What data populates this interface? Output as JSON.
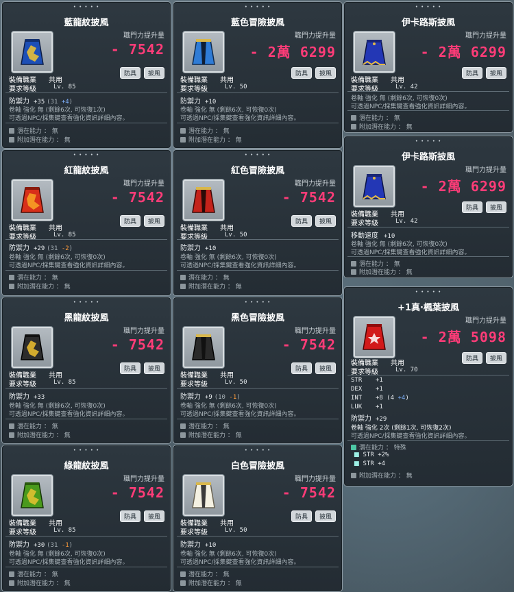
{
  "labels": {
    "atk_label": "職門力提升量",
    "badge_armor": "防具",
    "badge_cape": "披風",
    "job_label": "裝備職業",
    "job_value": "共用",
    "req_label": "要求等級",
    "stars": "• • • • •",
    "potential": "潛在能力 ： 無",
    "add_potential": "附加潛在能力 ： 無",
    "upgrade_text": "可透過NPC/採集鍵查看強化資訊詳細內容。"
  },
  "cards": {
    "c1": {
      "name": "藍龍紋披風",
      "atk": "- 7542",
      "lvl": "Lv. 85",
      "def_label": "防禦力",
      "def": "+35",
      "def_extra_a": "(31 ",
      "def_extra_b": "+4",
      "def_extra_c": ")",
      "scroll": "卷軸 強化 無 (剩餘6次, 可恢復1次)"
    },
    "c2": {
      "name": "藍色冒險披風",
      "atk": "- 2萬 6299",
      "lvl": "Lv. 50",
      "def_label": "防禦力",
      "def": "+10",
      "scroll": "卷軸 強化 無 (剩餘6次, 可恢復0次)"
    },
    "c3": {
      "name": "伊卡路斯披風",
      "atk": "- 2萬 6299",
      "lvl": "Lv. 42",
      "scroll": "卷軸 強化 無 (剩餘6次, 可恢復0次)"
    },
    "c4": {
      "name": "紅龍紋披風",
      "atk": "- 7542",
      "lvl": "Lv. 85",
      "def_label": "防禦力",
      "def": "+29",
      "def_extra_a": "(31 ",
      "def_extra_b": "-2",
      "def_extra_c": ")",
      "scroll": "卷軸 強化 無 (剩餘6次, 可恢復0次)"
    },
    "c5": {
      "name": "紅色冒險披風",
      "atk": "- 7542",
      "lvl": "Lv. 50",
      "def_label": "防禦力",
      "def": "+10",
      "scroll": "卷軸 強化 無 (剩餘6次, 可恢復0次)"
    },
    "c6": {
      "name": "伊卡路斯披風",
      "atk": "- 2萬 6299",
      "lvl": "Lv. 42",
      "stat_label": "移動速度",
      "stat": "+10",
      "scroll": "卷軸 強化 無 (剩餘6次, 可恢復0次)"
    },
    "c7": {
      "name": "黑龍紋披風",
      "atk": "- 7542",
      "lvl": "Lv. 85",
      "def_label": "防禦力",
      "def": "+33",
      "scroll": "卷軸 強化 無 (剩餘6次, 可恢復0次)"
    },
    "c8": {
      "name": "黑色冒險披風",
      "atk": "- 7542",
      "lvl": "Lv. 50",
      "def_label": "防禦力",
      "def": "+9",
      "def_extra_a": "(10 ",
      "def_extra_b": "-1",
      "def_extra_c": ")",
      "scroll": "卷軸 強化 無 (剩餘6次, 可恢復0次)"
    },
    "c9": {
      "name": "+1真·楓葉披風",
      "atk": "- 2萬 5098",
      "lvl": "Lv. 70",
      "stats": [
        {
          "k": "STR",
          "v": "+1"
        },
        {
          "k": "DEX",
          "v": "+1"
        },
        {
          "k": "INT",
          "v": "+8 (4 ",
          "extra": "+4",
          "close": ")"
        },
        {
          "k": "LUK",
          "v": "+1"
        }
      ],
      "def_label": "防禦力",
      "def": "+29",
      "scroll": "卷軸 強化 2次 (剩餘1次, 可恢復2次)",
      "pot_title": "潛在能力 ： 特殊",
      "pot_lines": [
        "STR +2%",
        "STR +4"
      ]
    },
    "c10": {
      "name": "綠龍紋披風",
      "atk": "- 7542",
      "lvl": "Lv. 85",
      "def_label": "防禦力",
      "def": "+30",
      "def_extra_a": "(31 ",
      "def_extra_b": "-1",
      "def_extra_c": ")",
      "scroll": "卷軸 強化 無 (剩餘6次, 可恢復0次)"
    },
    "c11": {
      "name": "白色冒險披風",
      "atk": "- 7542",
      "lvl": "Lv. 50",
      "def_label": "防禦力",
      "def": "+10",
      "scroll": "卷軸 強化 無 (剩餘6次, 可恢復0次)"
    }
  }
}
